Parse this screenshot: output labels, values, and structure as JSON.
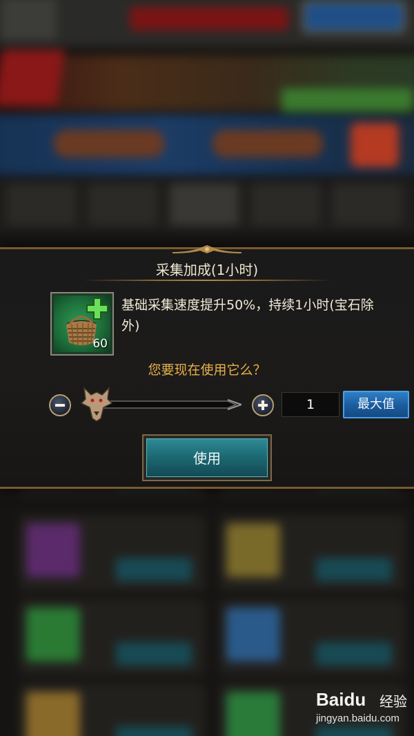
{
  "dialog": {
    "title": "采集加成(1小时)",
    "item": {
      "count": "60",
      "description": "基础采集速度提升50%，持续1小时(宝石除外)"
    },
    "question": "您要现在使用它么？",
    "quantity": "1",
    "quantity_fraction": 0.0,
    "max_label": "最大值",
    "use_label": "使用"
  },
  "watermark": {
    "logo": "Baidu",
    "chinese": "经验",
    "url": "jingyan.baidu.com"
  },
  "colors": {
    "question": "#e8b04a",
    "max_button": "#1b5c9e",
    "use_button": "#1d6a74",
    "frame_gold": "#7a5a2c"
  }
}
